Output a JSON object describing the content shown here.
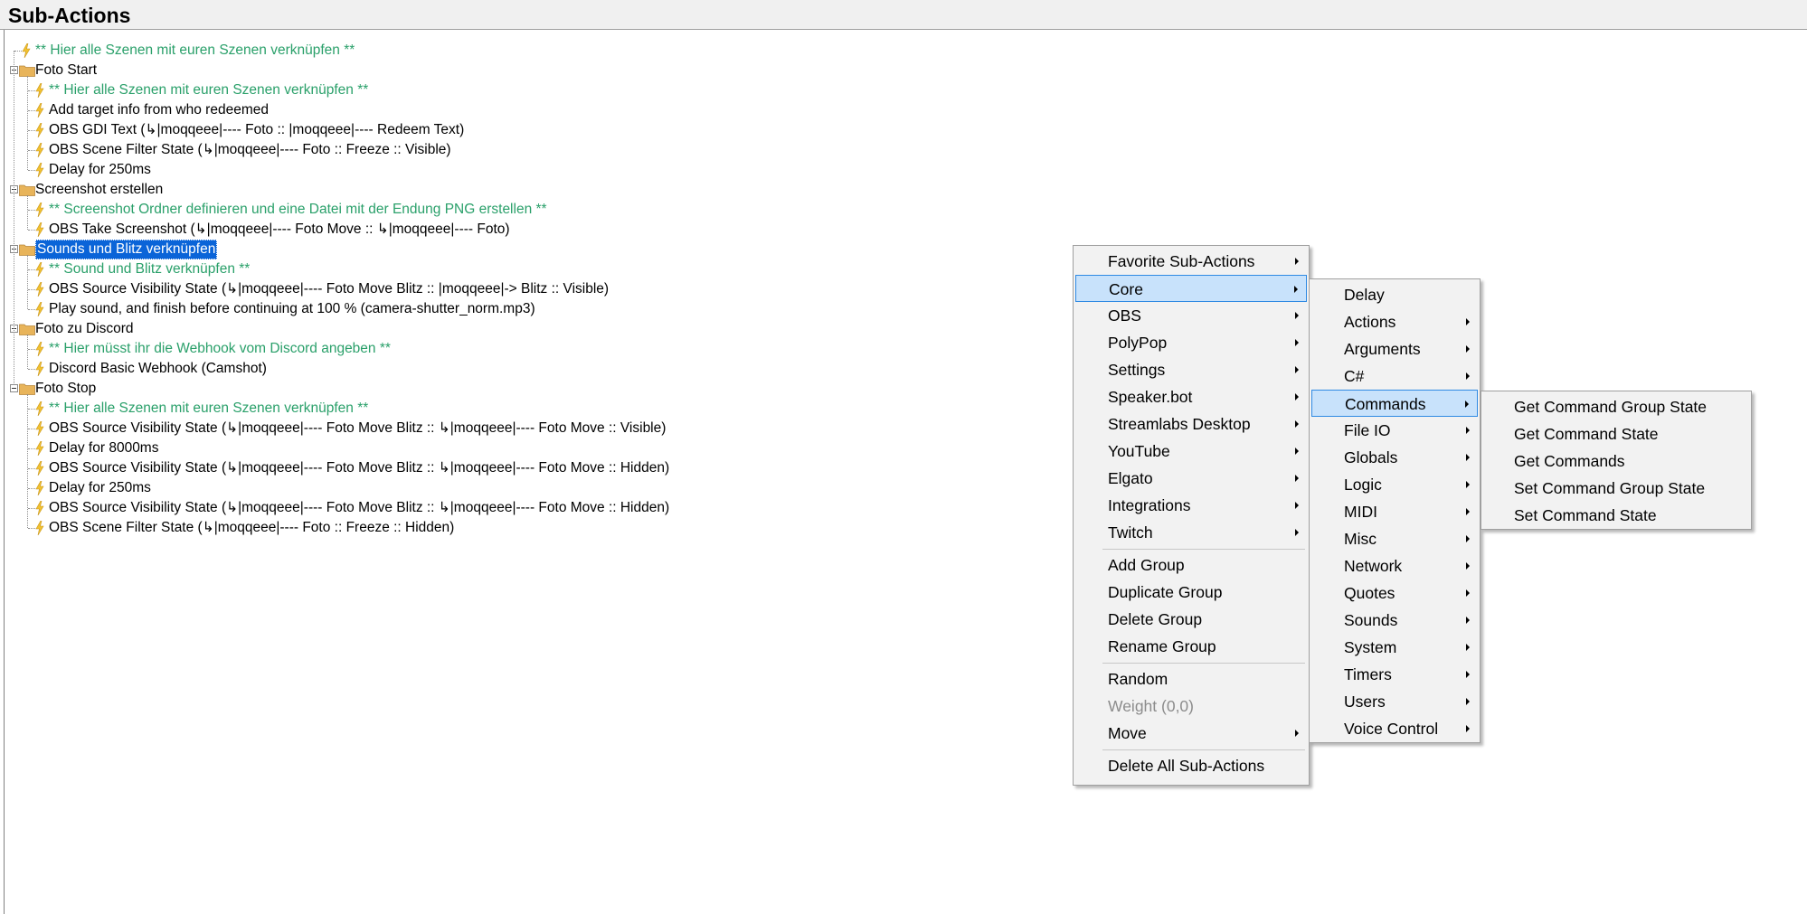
{
  "header": {
    "title": "Sub-Actions"
  },
  "tree": {
    "rows": [
      {
        "label": "** Hier alle Szenen mit euren Szenen verknüpfen **",
        "type": "comment"
      },
      {
        "label": "Foto Start",
        "type": "group"
      },
      {
        "label": "** Hier alle Szenen mit euren Szenen verknüpfen **",
        "type": "comment"
      },
      {
        "label": "Add target info from who redeemed",
        "type": "action"
      },
      {
        "label": "OBS GDI Text (↳|moqqeee|---- Foto :: |moqqeee|---- Redeem Text)",
        "type": "action"
      },
      {
        "label": "OBS Scene Filter State (↳|moqqeee|---- Foto :: Freeze :: Visible)",
        "type": "action"
      },
      {
        "label": "Delay for 250ms",
        "type": "action"
      },
      {
        "label": "Screenshot erstellen",
        "type": "group"
      },
      {
        "label": "** Screenshot Ordner definieren und eine Datei mit der Endung PNG erstellen **",
        "type": "comment"
      },
      {
        "label": "OBS Take Screenshot (↳|moqqeee|---- Foto Move :: ↳|moqqeee|---- Foto)",
        "type": "action"
      },
      {
        "label": "Sounds und Blitz verknüpfen",
        "type": "group",
        "selected": true
      },
      {
        "label": "** Sound und Blitz verknüpfen **",
        "type": "comment"
      },
      {
        "label": "OBS Source Visibility State (↳|moqqeee|---- Foto Move Blitz :: |moqqeee|-> Blitz :: Visible)",
        "type": "action"
      },
      {
        "label": "Play sound, and finish before continuing at 100 % (camera-shutter_norm.mp3)",
        "type": "action"
      },
      {
        "label": "Foto zu Discord",
        "type": "group"
      },
      {
        "label": "** Hier müsst ihr die Webhook vom Discord angeben **",
        "type": "comment"
      },
      {
        "label": "Discord Basic Webhook (Camshot)",
        "type": "action"
      },
      {
        "label": "Foto Stop",
        "type": "group"
      },
      {
        "label": "** Hier alle Szenen mit euren Szenen verknüpfen **",
        "type": "comment"
      },
      {
        "label": "OBS Source Visibility State (↳|moqqeee|---- Foto Move Blitz :: ↳|moqqeee|---- Foto Move :: Visible)",
        "type": "action"
      },
      {
        "label": "Delay for 8000ms",
        "type": "action"
      },
      {
        "label": "OBS Source Visibility State (↳|moqqeee|---- Foto Move Blitz :: ↳|moqqeee|---- Foto Move :: Hidden)",
        "type": "action"
      },
      {
        "label": "Delay for 250ms",
        "type": "action"
      },
      {
        "label": "OBS Source Visibility State (↳|moqqeee|---- Foto Move Blitz :: ↳|moqqeee|---- Foto Move :: Hidden)",
        "type": "action"
      },
      {
        "label": "OBS Scene Filter State (↳|moqqeee|---- Foto :: Freeze :: Hidden)",
        "type": "action"
      }
    ]
  },
  "context_menu": {
    "items": [
      {
        "label": "Favorite Sub-Actions",
        "submenu": true
      },
      {
        "label": "Core",
        "submenu": true,
        "highlighted": true
      },
      {
        "label": "OBS",
        "submenu": true
      },
      {
        "label": "PolyPop",
        "submenu": true
      },
      {
        "label": "Settings",
        "submenu": true
      },
      {
        "label": "Speaker.bot",
        "submenu": true
      },
      {
        "label": "Streamlabs Desktop",
        "submenu": true
      },
      {
        "label": "YouTube",
        "submenu": true
      },
      {
        "label": "Elgato",
        "submenu": true
      },
      {
        "label": "Integrations",
        "submenu": true
      },
      {
        "label": "Twitch",
        "submenu": true
      },
      {
        "label": "Add Group"
      },
      {
        "label": "Duplicate Group"
      },
      {
        "label": "Delete Group"
      },
      {
        "label": "Rename Group"
      },
      {
        "label": "Random"
      },
      {
        "label": "Weight (0,0)",
        "disabled": true
      },
      {
        "label": "Move",
        "submenu": true
      },
      {
        "label": "Delete All Sub-Actions"
      }
    ]
  },
  "core_submenu": {
    "items": [
      {
        "label": "Delay"
      },
      {
        "label": "Actions",
        "submenu": true
      },
      {
        "label": "Arguments",
        "submenu": true
      },
      {
        "label": "C#",
        "submenu": true
      },
      {
        "label": "Commands",
        "submenu": true,
        "highlighted": true
      },
      {
        "label": "File IO",
        "submenu": true
      },
      {
        "label": "Globals",
        "submenu": true
      },
      {
        "label": "Logic",
        "submenu": true
      },
      {
        "label": "MIDI",
        "submenu": true
      },
      {
        "label": "Misc",
        "submenu": true
      },
      {
        "label": "Network",
        "submenu": true
      },
      {
        "label": "Quotes",
        "submenu": true
      },
      {
        "label": "Sounds",
        "submenu": true
      },
      {
        "label": "System",
        "submenu": true
      },
      {
        "label": "Timers",
        "submenu": true
      },
      {
        "label": "Users",
        "submenu": true
      },
      {
        "label": "Voice Control",
        "submenu": true
      }
    ]
  },
  "commands_submenu": {
    "items": [
      {
        "label": "Get Command Group State"
      },
      {
        "label": "Get Command State"
      },
      {
        "label": "Get Commands"
      },
      {
        "label": "Set Command Group State"
      },
      {
        "label": "Set Command State"
      }
    ]
  },
  "colors": {
    "comment_text": "#2aa06a",
    "selection_bg": "#0a64d8",
    "menu_highlight_bg": "#c8e2fb",
    "menu_highlight_border": "#2f8ae3",
    "bolt_icon": "#f2c230",
    "folder_icon": "#e8b45a"
  }
}
